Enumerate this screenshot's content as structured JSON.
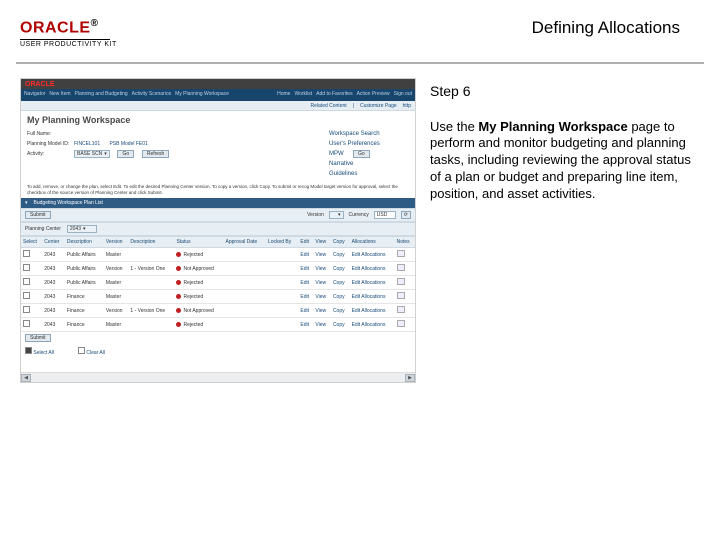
{
  "header": {
    "brand": "ORACLE",
    "brand_sub": "USER PRODUCTIVITY KIT",
    "page_title": "Defining Allocations"
  },
  "instructions": {
    "step_label": "Step 6",
    "text_before": "Use the ",
    "text_strong": "My Planning Workspace",
    "text_after": " page to perform and monitor budgeting and planning tasks, including reviewing the approval status of a plan or budget and preparing line item, position, and asset activities."
  },
  "app": {
    "brand": "ORACLE",
    "nav_left": [
      "Navigator",
      "New Item",
      "Planning and Budgeting",
      "Activity Scenarios",
      "My Planning Workspace"
    ],
    "nav_right": [
      "Home",
      "Worklist",
      "Add to Favorites",
      "Action Preview",
      "Sign out"
    ],
    "subnav": {
      "related": "Related Content",
      "customize": "Customize Page",
      "http": "http"
    },
    "title": "My Planning Workspace",
    "form": {
      "left": [
        {
          "label": "Full Name:",
          "value": ""
        },
        {
          "label": "Planning Model ID:",
          "value": "FINCEL101",
          "extra_label": "PSB Model FE01"
        },
        {
          "label": "Activity:",
          "value": "BASE SCN"
        },
        {
          "label": "",
          "value": "",
          "go_btn": "Go",
          "refresh_btn": "Refresh"
        }
      ],
      "right": [
        "Workspace Search",
        "User's Preferences",
        "MPW",
        "Narrative",
        "Guidelines"
      ],
      "go_icon": "Go"
    },
    "note": "To add, remove, or change the plan, select Edit. To edit the desired Planning Center version. To copy a version, click Copy. To submit or recog Model target version for approval, select the checkbox of the source version of Planning Center and click Submit.",
    "section_label": "Budgeting Workspace Plan List",
    "filter": {
      "submit_btn": "Submit",
      "version_label": "Version",
      "curr_label": "Currency",
      "usd": "USD"
    },
    "grid": {
      "cols": [
        "Select",
        "Center",
        "Description",
        "Version",
        "Description",
        "Status",
        "Approval Date",
        "Locked By",
        "Edit",
        "View",
        "Copy",
        "Allocations",
        "Notes"
      ],
      "version_cell": "1 - Version One",
      "status_cell": "Rejected",
      "status_cell2": "Not Approved",
      "rows": [
        {
          "center": "2043",
          "desc": "Public Affairs",
          "version": "Master",
          "edit": "Edit",
          "view": "View",
          "copy": "Copy",
          "alloc": "Edit Allocations"
        },
        {
          "center": "2043",
          "desc": "Public Affairs",
          "version": "Version",
          "edit": "Edit",
          "view": "View",
          "copy": "Copy",
          "alloc": "Edit Allocations"
        },
        {
          "center": "2043",
          "desc": "Public Affairs",
          "version": "Master",
          "edit": "Edit",
          "view": "View",
          "copy": "Copy",
          "alloc": "Edit Allocations"
        },
        {
          "center": "2043",
          "desc": "Finance",
          "version": "Master",
          "edit": "Edit",
          "view": "View",
          "copy": "Copy",
          "alloc": "Edit Allocations"
        },
        {
          "center": "2043",
          "desc": "Finance",
          "version": "Version",
          "edit": "Edit",
          "view": "View",
          "copy": "Copy",
          "alloc": "Edit Allocations"
        },
        {
          "center": "2043",
          "desc": "Finance",
          "version": "Master",
          "edit": "Edit",
          "view": "View",
          "copy": "Copy",
          "alloc": "Edit Allocations"
        }
      ]
    },
    "footer": {
      "submit": "Submit",
      "selectall": "Select All",
      "clearall": "Clear All"
    }
  }
}
